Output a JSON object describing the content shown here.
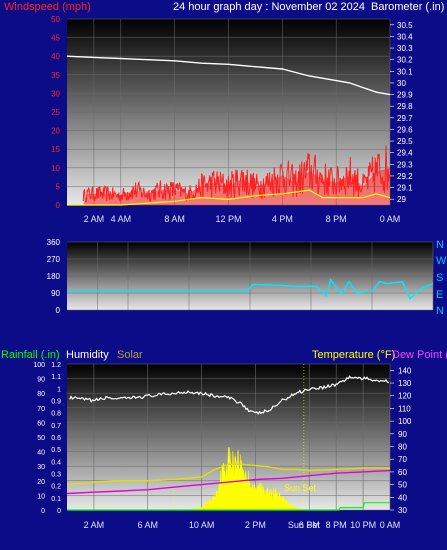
{
  "header": {
    "title": "24 hour graph day : November 02 2024",
    "wind_label": "Windspeed (mph)",
    "baro_label": "Barometer (.in)"
  },
  "compass_letters": [
    "N",
    "W",
    "S",
    "E",
    "N"
  ],
  "legend_bottom": {
    "rainfall": "Rainfall (.in)",
    "humidity": "Humidity",
    "solar": "Solar",
    "temperature": "Temperature (°F)",
    "dewpoint": "Dew Point ("
  },
  "annotations": {
    "sunset": "Sun Set"
  },
  "colors": {
    "background": "#0c0c88",
    "wind": "#ff2020",
    "gust": "#ffff00",
    "barometer": "#ffffff",
    "direction": "#00e8ff",
    "humidity": "#ffffff",
    "solar": "#ffff00",
    "temperature": "#e0e000",
    "dewpoint": "#e000e0",
    "rain": "#00ff00",
    "axis_wind": "#ff2020",
    "axis_text": "#ffffff",
    "tick_label": "#e0e0ff",
    "compass": "#00c0ff",
    "label_humidity": "#ffffff",
    "label_solar": "#b0a040",
    "label_temperature": "#ffff00",
    "label_dewpoint": "#ff40ff"
  },
  "chart_data": [
    {
      "name": "wind-barometer",
      "type": "line",
      "x_tick_labels": [
        "2 AM",
        "4 AM",
        "8 AM",
        "12 PM",
        "4 PM",
        "8 PM",
        "0 AM"
      ],
      "x_tick_hours": [
        2,
        4,
        8,
        12,
        16,
        20,
        24
      ],
      "y_left": {
        "label": "Windspeed (mph)",
        "ticks": [
          0,
          5,
          10,
          15,
          20,
          25,
          30,
          35,
          40,
          45,
          50
        ],
        "range": [
          0,
          50
        ]
      },
      "y_right": {
        "label": "Barometer (.in)",
        "ticks": [
          "29",
          "29.1",
          "29.2",
          "29.3",
          "29.4",
          "29.5",
          "29.6",
          "29.7",
          "29.8",
          "29.9",
          "30",
          "30.1",
          "30.2",
          "30.3",
          "30.4",
          "30.5"
        ],
        "range": [
          28.95,
          30.55
        ]
      },
      "series": [
        {
          "name": "Barometer (.in)",
          "axis": "right",
          "points": [
            [
              0,
              30.23
            ],
            [
              2,
              30.22
            ],
            [
              4,
              30.21
            ],
            [
              6,
              30.2
            ],
            [
              8,
              30.19
            ],
            [
              10,
              30.17
            ],
            [
              12,
              30.16
            ],
            [
              14,
              30.14
            ],
            [
              16,
              30.12
            ],
            [
              17,
              30.09
            ],
            [
              18,
              30.06
            ],
            [
              20,
              30.02
            ],
            [
              21,
              30.0
            ],
            [
              22,
              29.96
            ],
            [
              23,
              29.92
            ],
            [
              24,
              29.9
            ]
          ]
        },
        {
          "name": "Windspeed",
          "axis": "left",
          "points": [
            [
              0,
              1
            ],
            [
              1,
              2
            ],
            [
              1.5,
              3
            ],
            [
              2,
              3
            ],
            [
              3,
              3
            ],
            [
              4,
              2.5
            ],
            [
              5,
              4
            ],
            [
              6,
              3
            ],
            [
              7,
              4
            ],
            [
              8,
              4
            ],
            [
              9,
              3
            ],
            [
              10,
              5
            ],
            [
              11,
              6
            ],
            [
              12,
              5
            ],
            [
              13,
              7
            ],
            [
              14,
              5
            ],
            [
              15,
              6
            ],
            [
              16,
              8
            ],
            [
              17,
              6
            ],
            [
              18,
              9
            ],
            [
              19,
              7
            ],
            [
              20,
              6
            ],
            [
              21,
              8
            ],
            [
              22,
              5
            ],
            [
              23,
              9
            ],
            [
              24,
              10
            ]
          ]
        },
        {
          "name": "Gust",
          "axis": "left",
          "points": [
            [
              0,
              0
            ],
            [
              2,
              0
            ],
            [
              4,
              0
            ],
            [
              6,
              0.5
            ],
            [
              8,
              1
            ],
            [
              10,
              2
            ],
            [
              12,
              1.5
            ],
            [
              14,
              2.5
            ],
            [
              16,
              3
            ],
            [
              18,
              4
            ],
            [
              19,
              2
            ],
            [
              20,
              2
            ],
            [
              22,
              2
            ],
            [
              23,
              3
            ],
            [
              24,
              2
            ]
          ]
        }
      ]
    },
    {
      "name": "wind-direction",
      "type": "line",
      "x_tick_hours": [
        2,
        4,
        8,
        12,
        16,
        20,
        24
      ],
      "y": {
        "ticks": [
          "0",
          "90",
          "180",
          "270",
          "360"
        ],
        "range": [
          0,
          360
        ]
      },
      "series": [
        {
          "name": "Wind Direction",
          "points": [
            [
              0,
              100
            ],
            [
              2,
              100
            ],
            [
              4,
              100
            ],
            [
              6,
              100
            ],
            [
              8,
              100
            ],
            [
              10,
              100
            ],
            [
              11.8,
              100
            ],
            [
              12.2,
              135
            ],
            [
              14,
              130
            ],
            [
              15,
              125
            ],
            [
              16.4,
              125
            ],
            [
              17,
              75
            ],
            [
              17.3,
              160
            ],
            [
              17.8,
              100
            ],
            [
              18,
              85
            ],
            [
              18.5,
              150
            ],
            [
              19,
              90
            ],
            [
              20,
              100
            ],
            [
              20.5,
              150
            ],
            [
              21,
              140
            ],
            [
              22,
              150
            ],
            [
              22.5,
              60
            ],
            [
              23,
              100
            ],
            [
              23.4,
              120
            ],
            [
              24,
              140
            ]
          ]
        }
      ]
    },
    {
      "name": "rain-humidity-solar-temperature",
      "type": "line",
      "x_tick_labels": [
        "2 AM",
        "6 AM",
        "10 AM",
        "2 PM",
        "Sun Set",
        "6 PM",
        "8 PM",
        "10 PM",
        "0 AM"
      ],
      "x_tick_hours": [
        2,
        6,
        10,
        14,
        17.6,
        18,
        20,
        22,
        24
      ],
      "y_humidity": {
        "ticks": [
          "0",
          "10",
          "20",
          "30",
          "40",
          "50",
          "60",
          "70",
          "80",
          "90",
          "100"
        ],
        "range": [
          0,
          100
        ]
      },
      "y_rain": {
        "ticks": [
          "0",
          "0.1",
          "0.2",
          "0.3",
          "0.4",
          "0.5",
          "0.6",
          "0.7",
          "0.8",
          "0.9",
          "1",
          "1.1",
          "1.2"
        ],
        "range": [
          0,
          1.2
        ]
      },
      "y_temperature": {
        "ticks": [
          "30",
          "40",
          "50",
          "60",
          "70",
          "80",
          "90",
          "100",
          "110",
          "120",
          "130",
          "140"
        ],
        "range": [
          30,
          145
        ]
      },
      "series": [
        {
          "name": "Humidity",
          "axis": "humidity",
          "points": [
            [
              0,
              77
            ],
            [
              1,
              76
            ],
            [
              2,
              75
            ],
            [
              3,
              77
            ],
            [
              4,
              76
            ],
            [
              6,
              78
            ],
            [
              8,
              80
            ],
            [
              9,
              81
            ],
            [
              10,
              80
            ],
            [
              11,
              78
            ],
            [
              12,
              77
            ],
            [
              13,
              73
            ],
            [
              13.5,
              68
            ],
            [
              14,
              66
            ],
            [
              15,
              68
            ],
            [
              16,
              75
            ],
            [
              17,
              80
            ],
            [
              18,
              83
            ],
            [
              19,
              84
            ],
            [
              20,
              86
            ],
            [
              21,
              91
            ],
            [
              22,
              90
            ],
            [
              23,
              89
            ],
            [
              24,
              88
            ]
          ]
        },
        {
          "name": "Temperature (°F)",
          "axis": "temperature",
          "points": [
            [
              0,
              50
            ],
            [
              2,
              52
            ],
            [
              4,
              53
            ],
            [
              6,
              53
            ],
            [
              8,
              54
            ],
            [
              10,
              56
            ],
            [
              11,
              62
            ],
            [
              12,
              66
            ],
            [
              13,
              66
            ],
            [
              14,
              65
            ],
            [
              15,
              64
            ],
            [
              16,
              62
            ],
            [
              17,
              62
            ],
            [
              18,
              61
            ],
            [
              20,
              62
            ],
            [
              22,
              63
            ],
            [
              24,
              63
            ]
          ]
        },
        {
          "name": "Dew Point",
          "axis": "temperature",
          "points": [
            [
              0,
              43
            ],
            [
              2,
              44
            ],
            [
              4,
              45
            ],
            [
              6,
              46
            ],
            [
              8,
              48
            ],
            [
              10,
              50
            ],
            [
              12,
              52
            ],
            [
              14,
              54
            ],
            [
              16,
              55
            ],
            [
              18,
              57
            ],
            [
              20,
              59
            ],
            [
              22,
              60
            ],
            [
              24,
              61
            ]
          ]
        },
        {
          "name": "Solar",
          "axis": "humidity",
          "points": [
            [
              9,
              0
            ],
            [
              10,
              2
            ],
            [
              10.5,
              6
            ],
            [
              11,
              10
            ],
            [
              11.5,
              28
            ],
            [
              12,
              40
            ],
            [
              12.3,
              36
            ],
            [
              12.6,
              42
            ],
            [
              13,
              33
            ],
            [
              13.5,
              24
            ],
            [
              14,
              15
            ],
            [
              14.5,
              20
            ],
            [
              15,
              12
            ],
            [
              15.5,
              14
            ],
            [
              16,
              9
            ],
            [
              16.5,
              5
            ],
            [
              17,
              2
            ],
            [
              17.6,
              0
            ]
          ]
        },
        {
          "name": "Rainfall (.in)",
          "axis": "rain",
          "points": [
            [
              0,
              0
            ],
            [
              20.2,
              0
            ],
            [
              20.3,
              0.02
            ],
            [
              22,
              0.02
            ],
            [
              22.1,
              0.06
            ],
            [
              24,
              0.06
            ]
          ]
        }
      ]
    }
  ]
}
